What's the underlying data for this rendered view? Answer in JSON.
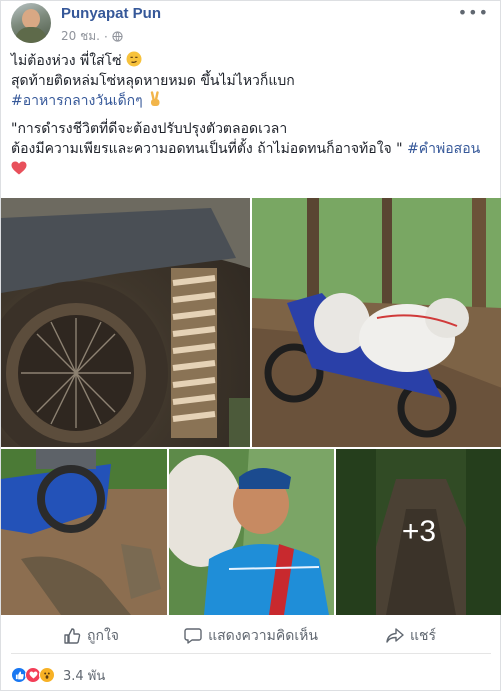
{
  "post": {
    "author": "Punyapat Pun",
    "time": "20 ชม.",
    "time_sep": "·",
    "more_label": "•••",
    "lines": {
      "line1": "ไม่ต้องห่วง พี่ใส่โซ่ ",
      "line2": "สุดท้ายติดหล่มโซ่หลุดหายหมด ขึ้นไม่ไหวก็แบก",
      "hashtag1": "#อาหารกลางวันเด็กๆ",
      "quote1": "\"การดำรงชีวิตที่ดีจะต้องปรับปรุงตัวตลอดเวลา",
      "quote2": "ต้องมีความเพียรและความอดทนเป็นที่ตั้ง ถ้าไม่อดทนก็อาจท้อใจ \" ",
      "hashtag2": "#คำพ่อสอน"
    },
    "photos": {
      "more_count": "+3"
    },
    "actions": {
      "like": "ถูกใจ",
      "comment": "แสดงความคิดเห็น",
      "share": "แชร์"
    },
    "reactions": {
      "count": "3.4 พัน",
      "icons": [
        "like-reaction",
        "love-reaction",
        "wow-reaction"
      ]
    },
    "colors": {
      "link": "#365899",
      "like_blue": "#1877f2",
      "love_red": "#f33e58",
      "wow_yellow": "#f7b125",
      "meta_gray": "#90949c"
    }
  }
}
